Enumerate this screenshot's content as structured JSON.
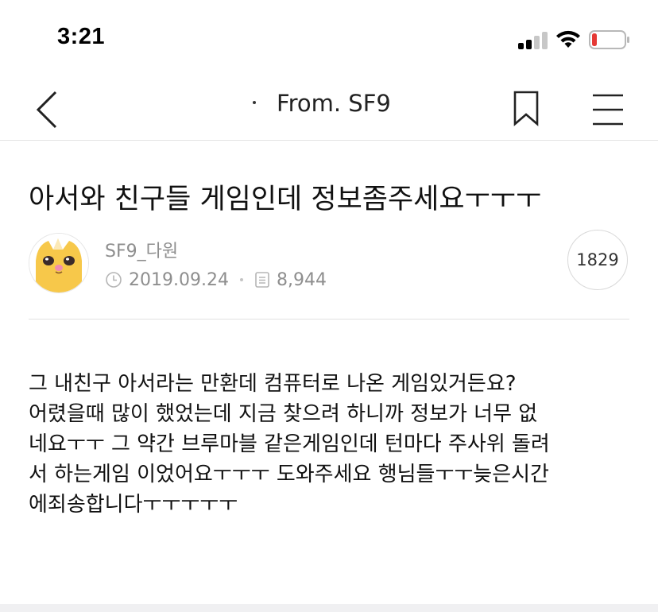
{
  "status_bar": {
    "time": "3:21",
    "icons": [
      "signal-icon",
      "wifi-icon",
      "battery-low-icon"
    ],
    "battery_color": "#e53935"
  },
  "nav": {
    "title": "From. SF9",
    "icons": [
      "back-icon",
      "bookmark-icon",
      "menu-icon"
    ]
  },
  "post": {
    "title": "아서와 친구들 게임인데 정보좀주세요ㅜㅜㅜ",
    "author": "SF9_다원",
    "date": "2019.09.24",
    "views": "8,944",
    "badge_count": "1829",
    "body_lines": [
      "그 내친구 아서라는 만환데 컴퓨터로 나온 게임있거든요?",
      "어렸을때 많이 했었는데 지금 찾으려 하니까 정보가 너무 없",
      "네요ㅜㅜ 그 약간 브루마블 같은게임인데 턴마다 주사위 돌려",
      "서 하는게임 이었어요ㅜㅜㅜ 도와주세요 행님들ㅜㅜ늦은시간",
      "에죄송합니다ㅜㅜㅜㅜㅜ"
    ]
  },
  "colors": {
    "accent_text": "#111111",
    "meta_text": "#8e8e8e",
    "avatar_yellow": "#f7c84a"
  }
}
